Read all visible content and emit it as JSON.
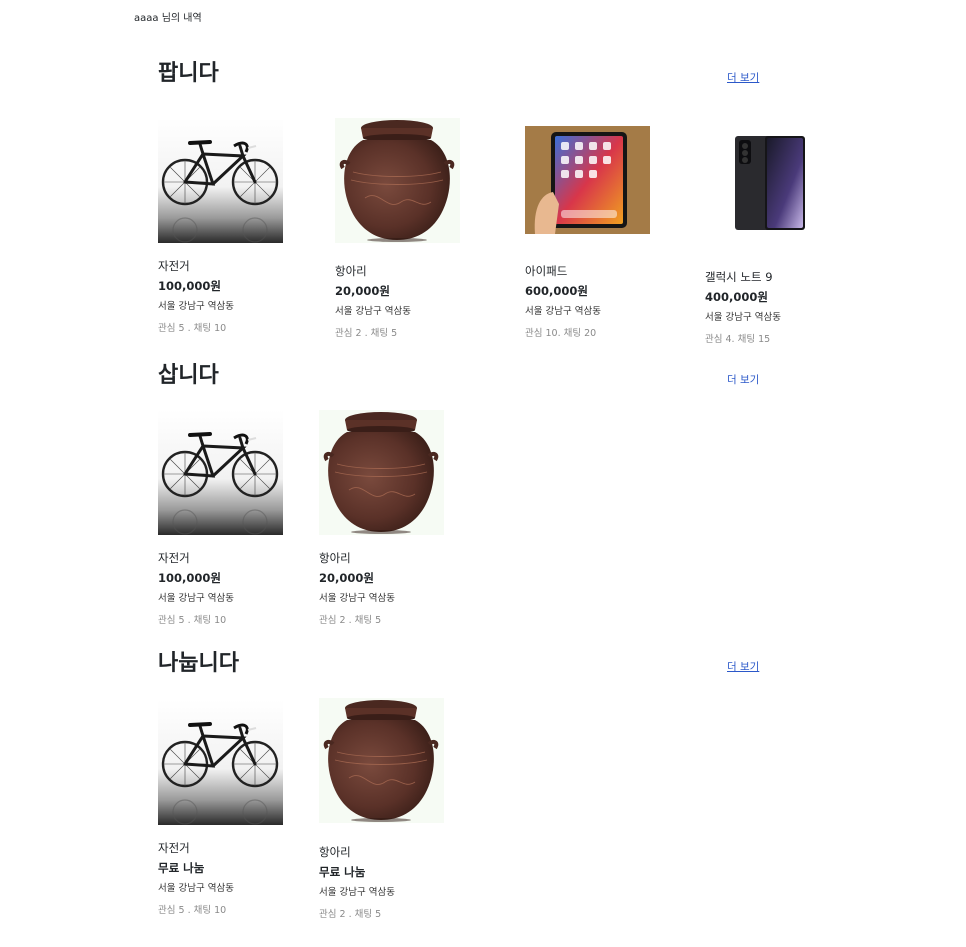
{
  "header": {
    "user_title": "aaaa 님의 내역"
  },
  "sections": [
    {
      "title": "팝니다",
      "more_label": "더 보기",
      "items": [
        {
          "name": "자전거",
          "price": "100,000원",
          "location": "서울 강남구 역삼동",
          "stats": "관심 5 . 채팅 10",
          "image": "bicycle"
        },
        {
          "name": "항아리",
          "price": "20,000원",
          "location": "서울 강남구 역삼동",
          "stats": "관심 2 . 채팅 5",
          "image": "jar"
        },
        {
          "name": "아이패드",
          "price": "600,000원",
          "location": "서울 강남구 역삼동",
          "stats": "관심 10. 채팅 20",
          "image": "tablet"
        },
        {
          "name": "갤럭시 노트 9",
          "price": "400,000원",
          "location": "서울 강남구 역삼동",
          "stats": "관심 4. 채팅 15",
          "image": "phone"
        }
      ]
    },
    {
      "title": "삽니다",
      "more_label": "더 보기",
      "items": [
        {
          "name": "자전거",
          "price": "100,000원",
          "location": "서울 강남구 역삼동",
          "stats": "관심 5 . 채팅 10",
          "image": "bicycle"
        },
        {
          "name": "항아리",
          "price": "20,000원",
          "location": "서울 강남구 역삼동",
          "stats": "관심 2 . 채팅 5",
          "image": "jar"
        }
      ]
    },
    {
      "title": "나눕니다",
      "more_label": "더 보기",
      "items": [
        {
          "name": "자전거",
          "price": "무료 나눔",
          "location": "서울 강남구 역삼동",
          "stats": "관심 5 . 채팅 10",
          "image": "bicycle"
        },
        {
          "name": "항아리",
          "price": "무료 나눔",
          "location": "서울 강남구 역삼동",
          "stats": "관심 2 . 채팅 5",
          "image": "jar"
        }
      ]
    }
  ]
}
